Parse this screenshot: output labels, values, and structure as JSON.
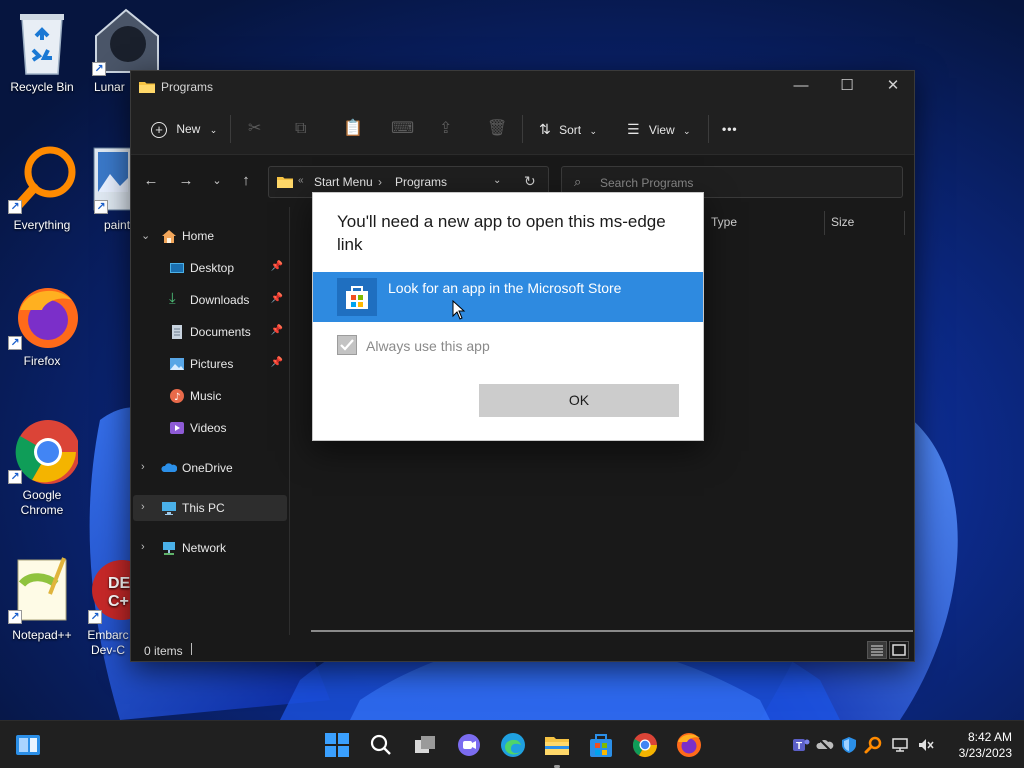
{
  "desktop": {
    "icons": [
      {
        "label": "Recycle Bin",
        "icon": "recycle-bin-icon"
      },
      {
        "label": "Lunar",
        "icon": "lunar-icon"
      },
      {
        "label": "Everything",
        "icon": "everything-icon"
      },
      {
        "label": "paint",
        "icon": "paint-icon"
      },
      {
        "label": "Firefox",
        "icon": "firefox-icon"
      },
      {
        "label": "Google Chrome",
        "icon": "chrome-icon"
      },
      {
        "label": "Notepad++",
        "icon": "notepadpp-icon"
      },
      {
        "label": "Embarc Dev-C",
        "icon": "devcpp-icon"
      }
    ]
  },
  "window": {
    "title": "Programs",
    "toolbar": {
      "new_label": "New",
      "sort_label": "Sort",
      "view_label": "View",
      "more_label": "•••"
    },
    "address": {
      "overflow": "«",
      "crumbs": [
        "Start Menu",
        "Programs"
      ]
    },
    "search": {
      "placeholder": "Search Programs"
    },
    "sidebar": {
      "items": [
        {
          "label": "Home",
          "icon": "home-icon"
        },
        {
          "label": "Desktop",
          "icon": "desktop-icon"
        },
        {
          "label": "Downloads",
          "icon": "downloads-icon"
        },
        {
          "label": "Documents",
          "icon": "documents-icon"
        },
        {
          "label": "Pictures",
          "icon": "pictures-icon"
        },
        {
          "label": "Music",
          "icon": "music-icon"
        },
        {
          "label": "Videos",
          "icon": "videos-icon"
        },
        {
          "label": "OneDrive",
          "icon": "onedrive-icon"
        },
        {
          "label": "This PC",
          "icon": "this-pc-icon"
        },
        {
          "label": "Network",
          "icon": "network-icon"
        }
      ]
    },
    "columns": {
      "type": "Type",
      "size": "Size"
    },
    "status": {
      "items": "0 items"
    }
  },
  "dialog": {
    "heading": "You'll need a new app to open this ms-edge link",
    "option_label": "Look for an app in the Microsoft Store",
    "always_label": "Always use this app",
    "always_checked": true,
    "ok_label": "OK"
  },
  "taskbar": {
    "apps": [
      "start-icon",
      "search-icon",
      "task-view-icon",
      "chat-icon",
      "edge-icon",
      "file-explorer-icon",
      "store-icon",
      "chrome-icon",
      "firefox-icon"
    ],
    "clock": {
      "time": "8:42 AM",
      "date": "3/23/2023"
    }
  },
  "colors": {
    "accent": "#2e8ae0",
    "window_bg": "#191919",
    "taskbar_bg": "#202020"
  }
}
